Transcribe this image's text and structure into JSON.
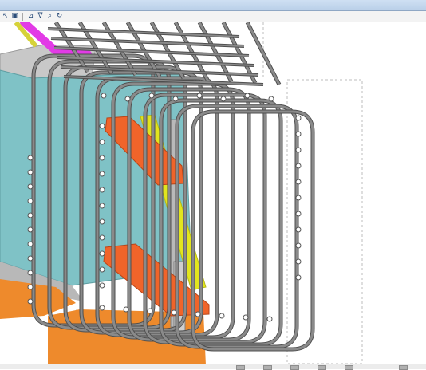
{
  "window": {
    "title": ""
  },
  "toolbar": {
    "buttons": [
      {
        "name": "pointer-tool-icon",
        "glyph": "↖"
      },
      {
        "name": "select-window-icon",
        "glyph": "▣"
      },
      {
        "name": "measure-icon",
        "glyph": "⊿"
      },
      {
        "name": "filter-icon",
        "glyph": "∇"
      },
      {
        "name": "zoom-icon",
        "glyph": "⌕"
      },
      {
        "name": "rotate-view-icon",
        "glyph": "↻"
      }
    ]
  },
  "scene": {
    "description_icon": "3d-rebar-cage-model",
    "colors": {
      "rebar": "#8a8a8a",
      "rebar_dark": "#4f4f4f",
      "concrete_face": "#7fc2c6",
      "concrete_top": "#c8c8c8",
      "steel_plate": "#f0642a",
      "diagonal_brace": "#e2e51e",
      "pipe": "#e23be6",
      "footing": "#ee8a2c",
      "vertical_beam": "#b9b9b9"
    }
  },
  "statusbar": {
    "icons": [
      "layout-icon",
      "snap-icon",
      "grid-icon",
      "ortho-icon",
      "view-icon",
      "settings-icon"
    ]
  }
}
